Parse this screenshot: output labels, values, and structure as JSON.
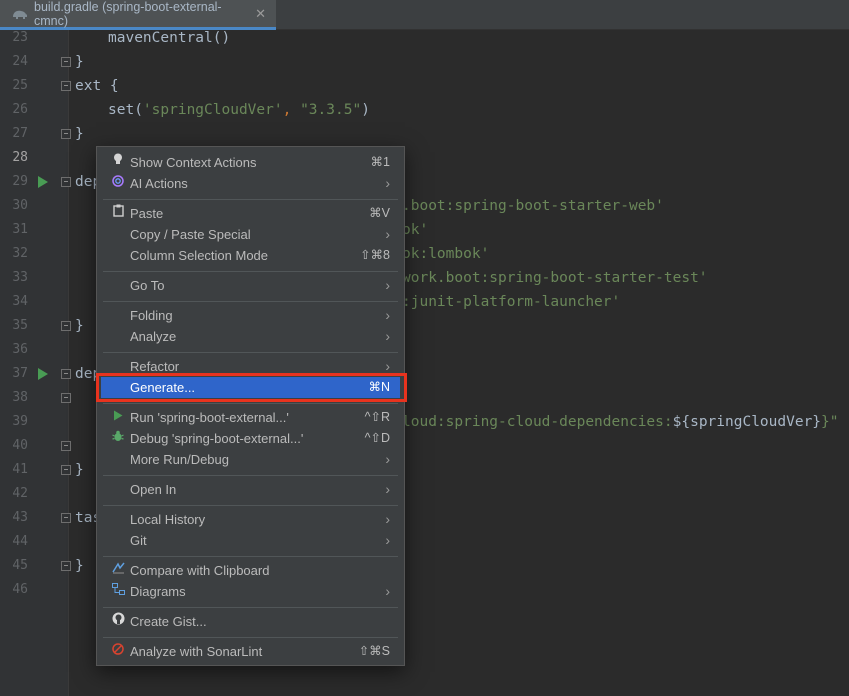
{
  "tab": {
    "title": "build.gradle (spring-boot-external-cmnc)",
    "close_glyph": "✕"
  },
  "gutter": {
    "line_numbers": [
      "23",
      "24",
      "25",
      "26",
      "27",
      "28",
      "29",
      "30",
      "31",
      "32",
      "33",
      "34",
      "35",
      "36",
      "37",
      "38",
      "39",
      "40",
      "41",
      "42",
      "43",
      "44",
      "45",
      "46"
    ]
  },
  "code": {
    "l23": "mavenCentral()",
    "l24": "}",
    "l25": "ext {",
    "l26_pre": "set(",
    "l26_s1": "'springCloudVer'",
    "l26_mid": ", ",
    "l26_s2": "\"3.3.5\"",
    "l26_post": ")",
    "l27": "}",
    "l29": "dep",
    "l30": ".boot:spring-boot-starter-web'",
    "l31": "ok'",
    "l32": "ok:lombok'",
    "l33": "work.boot:spring-boot-starter-test'",
    "l34": ":junit-platform-launcher'",
    "l35": "}",
    "l37": "dep",
    "l39_s": "loud:spring-cloud-dependencies:",
    "l39_v": "${springCloudVer}",
    "l39_e": "}\"",
    "l41": "}",
    "l43": "tas",
    "l45": "}"
  },
  "menu": {
    "items": [
      {
        "label": "Show Context Actions",
        "shortcut": "⌘1",
        "icon": "lightbulb-icon"
      },
      {
        "label": "AI Actions",
        "icon": "ai-spiral-icon",
        "submenu": true
      },
      {
        "label": "Paste",
        "shortcut": "⌘V",
        "icon": "clipboard-icon"
      },
      {
        "label": "Copy / Paste Special",
        "submenu": true
      },
      {
        "label": "Column Selection Mode",
        "shortcut": "⇧⌘8"
      },
      {
        "label": "Go To",
        "submenu": true
      },
      {
        "label": "Folding",
        "submenu": true
      },
      {
        "label": "Analyze",
        "submenu": true
      },
      {
        "label": "Refactor",
        "submenu": true
      },
      {
        "label": "Generate...",
        "shortcut": "⌘N",
        "selected": true
      },
      {
        "label": "Run 'spring-boot-external...'",
        "shortcut": "^⇧R",
        "icon": "run-icon"
      },
      {
        "label": "Debug 'spring-boot-external...'",
        "shortcut": "^⇧D",
        "icon": "debug-bug-icon"
      },
      {
        "label": "More Run/Debug",
        "submenu": true
      },
      {
        "label": "Open In",
        "submenu": true
      },
      {
        "label": "Local History",
        "submenu": true
      },
      {
        "label": "Git",
        "submenu": true
      },
      {
        "label": "Compare with Clipboard",
        "icon": "compare-icon"
      },
      {
        "label": "Diagrams",
        "icon": "diagram-icon",
        "submenu": true
      },
      {
        "label": "Create Gist...",
        "icon": "github-icon"
      },
      {
        "label": "Analyze with SonarLint",
        "shortcut": "⇧⌘S",
        "icon": "sonarlint-icon"
      }
    ],
    "arrow_glyph": "›"
  },
  "colors": {
    "editor_bg": "#2b2b2b",
    "menu_bg": "#3c3f41",
    "selection": "#2f65ca",
    "highlight_border": "#e8331e",
    "string": "#6a8759",
    "keyword": "#cc7832"
  }
}
